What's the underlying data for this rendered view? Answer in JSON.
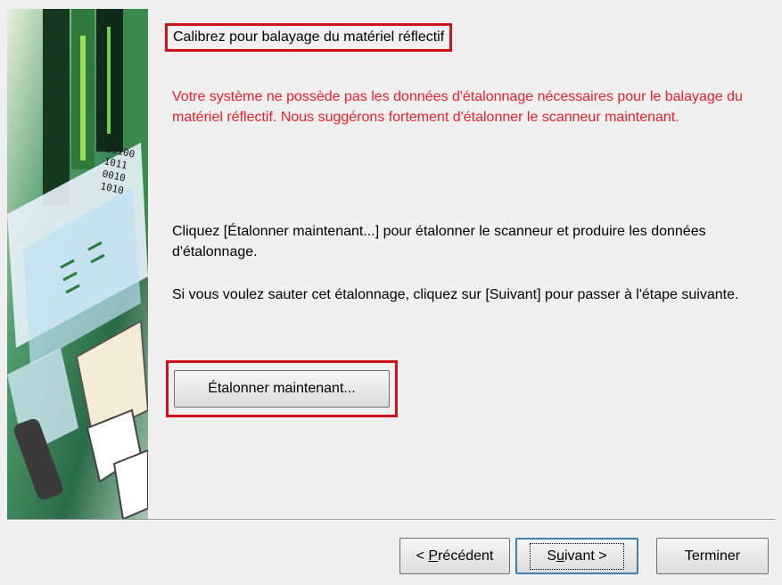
{
  "dialog": {
    "heading": "Calibrez pour balayage du matériel réflectif",
    "warning": "Votre système ne possède pas les données d'étalonnage nécessaires pour le balayage du matériel réflectif. Nous suggérons fortement d'étalonner le scanneur maintenant.",
    "instruction": "Cliquez [Étalonner maintenant...] pour étalonner le scanneur et produire les données d'étalonnage.",
    "skip_hint": "Si vous voulez sauter cet étalonnage, cliquez sur [Suivant] pour passer à l'étape suivante.",
    "calibrate_button": "Étalonner maintenant...",
    "colors": {
      "warning": "#e8202a",
      "highlight": "#d0101a"
    }
  },
  "footer": {
    "back_prefix": "< ",
    "back_key": "P",
    "back_rest": "récédent",
    "next_prefix": "S",
    "next_key": "u",
    "next_rest": "ivant >",
    "finish_label": "Terminer"
  },
  "sidebar": {
    "art_digits": [
      "10100",
      "1011",
      "0010",
      "1010"
    ]
  }
}
